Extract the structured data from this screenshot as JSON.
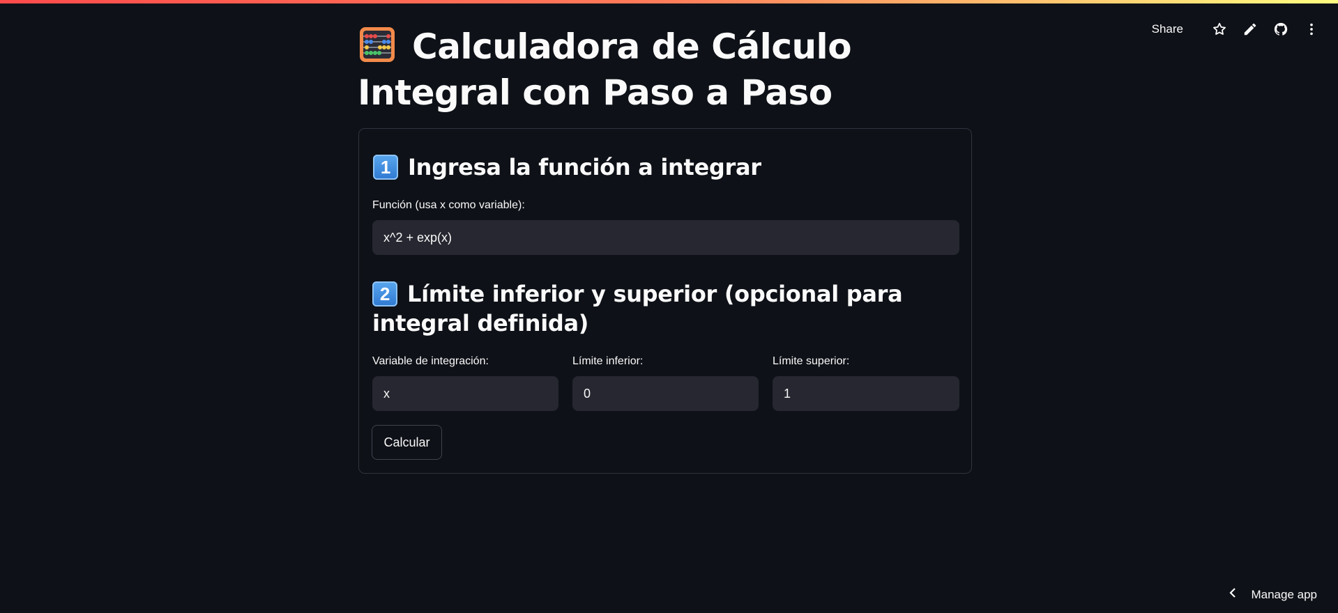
{
  "colors": {
    "background": "#0e1117",
    "input_bg": "#262730",
    "border": "#31333f",
    "accent_gradient_start": "#ff4b4b",
    "accent_gradient_end": "#fffd80"
  },
  "toolbar": {
    "share_label": "Share",
    "icons": [
      "star-icon",
      "pencil-icon",
      "github-icon",
      "more-vertical-icon"
    ]
  },
  "header": {
    "title": "Calculadora de Cálculo Integral con Paso a Paso",
    "title_icon": "abacus-icon"
  },
  "section1": {
    "number": "1",
    "heading": "Ingresa la función a integrar",
    "function_label": "Función (usa x como variable):",
    "function_value": "x^2 + exp(x)"
  },
  "section2": {
    "number": "2",
    "heading": "Límite inferior y superior (opcional para integral definida)",
    "variable_label": "Variable de integración:",
    "variable_value": "x",
    "lower_label": "Límite inferior:",
    "lower_value": "0",
    "upper_label": "Límite superior:",
    "upper_value": "1"
  },
  "calculate_button": "Calcular",
  "footer": {
    "manage_app_label": "Manage app"
  }
}
